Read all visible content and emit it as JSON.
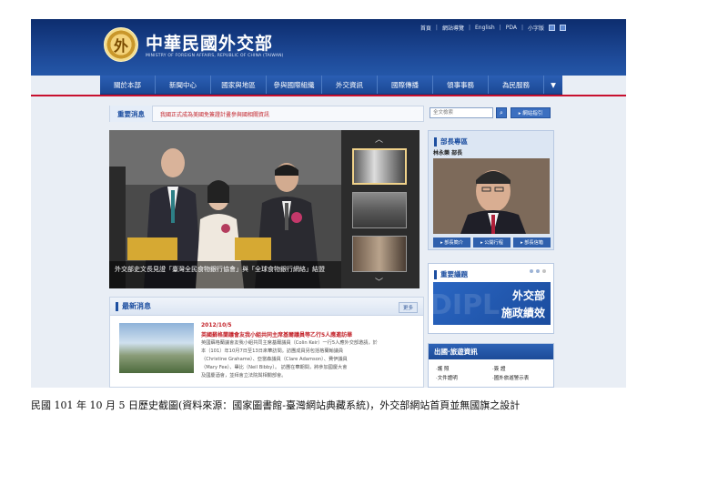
{
  "header": {
    "logo_glyph": "外",
    "title": "中華民國外交部",
    "subtitle": "MINISTRY OF FOREIGN AFFAIRS, REPUBLIC OF CHINA (TAIWAN)",
    "top_links": [
      "首頁",
      "網站導覽",
      "English",
      "PDA",
      "小字版"
    ]
  },
  "nav": {
    "items": [
      "關於本部",
      "新聞中心",
      "國家與地區",
      "參與國際組織",
      "外交資訊",
      "國際傳播",
      "領事事務",
      "為民服務",
      "▼"
    ]
  },
  "headline": {
    "tab": "重要消息",
    "text": "我國正式成為美國免簽證計畫參與國相關資訊"
  },
  "hero": {
    "caption": "外交部史文長見證「臺灣全民食物銀行協會」與「全球食物銀行網絡」結盟",
    "arrow_up": "︿",
    "arrow_down": "﹀"
  },
  "news": {
    "title": "最新消息",
    "more": "更多",
    "date": "2012/10/5",
    "headline": "英國蘇格蘭議會友我小組共同主席基爾議員等乙行5人應邀訪華",
    "lines": [
      "英國蘇格蘭議會友我小組共同主席基爾議員（Colin Keir）一行5人應外交部邀請，於",
      "本（101）年10月7日至13日來華訪問。訪團成員另包括格蘭翰議員",
      "（Christine Grahame）、亞當森議員（Clare Adamson）、費伊議員",
      "（Mary Fee）、畢比（Neil Bibby）。 訪團在華期間，將參加國慶大會",
      "及國慶酒會，並拜會立法院與相關部會。"
    ]
  },
  "search": {
    "placeholder": "全文檢索",
    "button": "⌕",
    "sitemap": "▸ 網站指引"
  },
  "minister": {
    "title": "部長專區",
    "name": "林永樂 部長",
    "links": [
      "▸ 部長簡介",
      "▸ 公開行程",
      "▸ 部長信箱"
    ]
  },
  "topics": {
    "title": "重要議題",
    "banner_line1": "外交部",
    "banner_line2": "施政績效",
    "watermark": "DIPL"
  },
  "travel": {
    "title": "出國‧旅遊資訊",
    "items": [
      "‧護 照",
      "‧簽 證",
      "‧文件證明",
      "‧國外旅遊警示表"
    ]
  },
  "page_caption": "民國 101 年 10 月 5 日歷史截圖(資料來源：國家圖書館-臺灣網站典藏系統)，外交部網站首頁並無國旗之設計",
  "colors": {
    "header_blue": "#1e4b9a",
    "accent_red": "#c3242b",
    "nav_blue": "#2b5fb4"
  }
}
